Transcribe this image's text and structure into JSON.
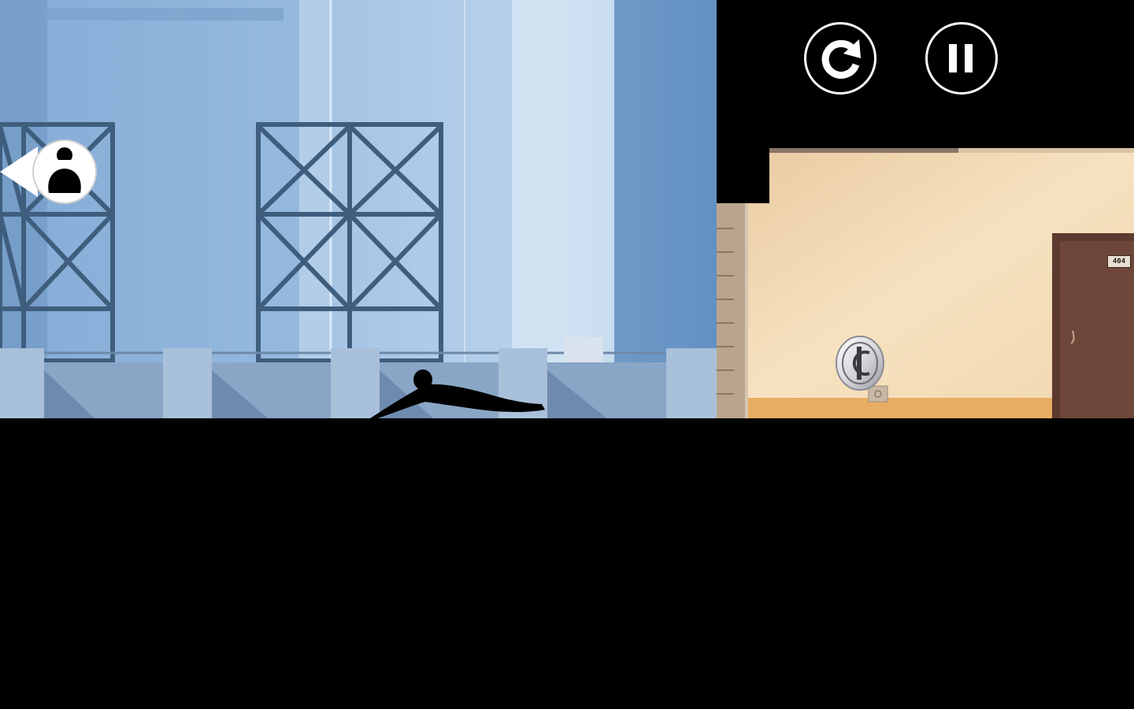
{
  "hud": {
    "restart_icon": "restart-icon",
    "pause_icon": "pause-icon"
  },
  "level": {
    "door_number": "404"
  },
  "indicator": {
    "icon": "pursuer-hunter-icon"
  },
  "pickup": {
    "icon": "bonus-coin-icon"
  },
  "colors": {
    "sky": "#a9c8e6",
    "steel": "#3c5a78",
    "interior_wall": "#f2dcb7",
    "floor": "#e6aa5c",
    "door": "#6b4437",
    "hud": "#ffffff",
    "ground": "#000000"
  }
}
